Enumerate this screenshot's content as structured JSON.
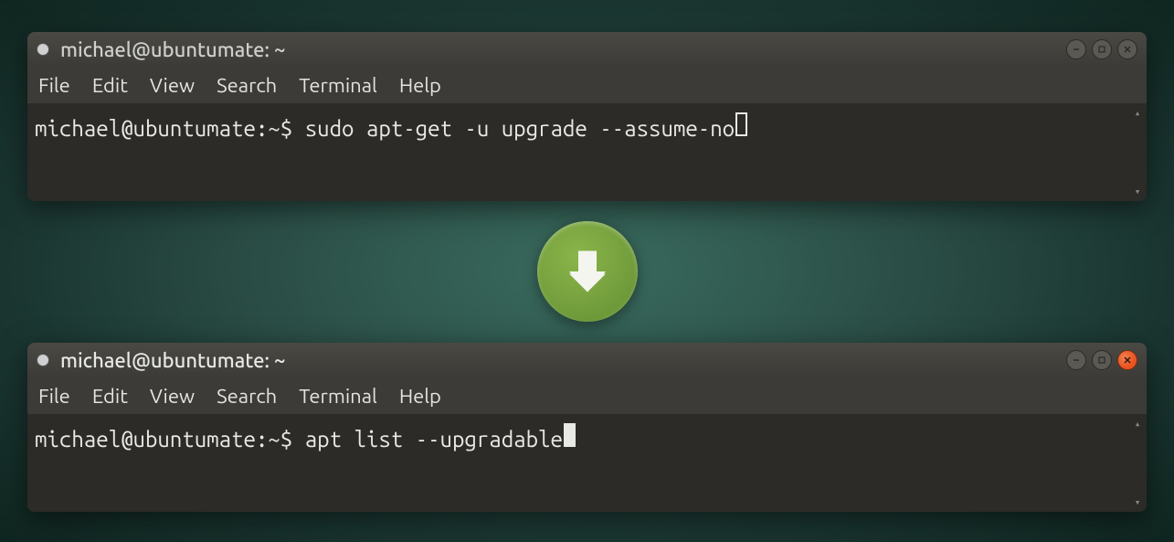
{
  "window1": {
    "title": "michael@ubuntumate: ~",
    "prompt": "michael@ubuntumate:~$ ",
    "command": "sudo apt-get -u upgrade --assume-no",
    "active": false
  },
  "window2": {
    "title": "michael@ubuntumate: ~",
    "prompt": "michael@ubuntumate:~$ ",
    "command": "apt list --upgradable",
    "active": true
  },
  "menus": {
    "file": "File",
    "edit": "Edit",
    "view": "View",
    "search": "Search",
    "terminal": "Terminal",
    "help": "Help"
  }
}
